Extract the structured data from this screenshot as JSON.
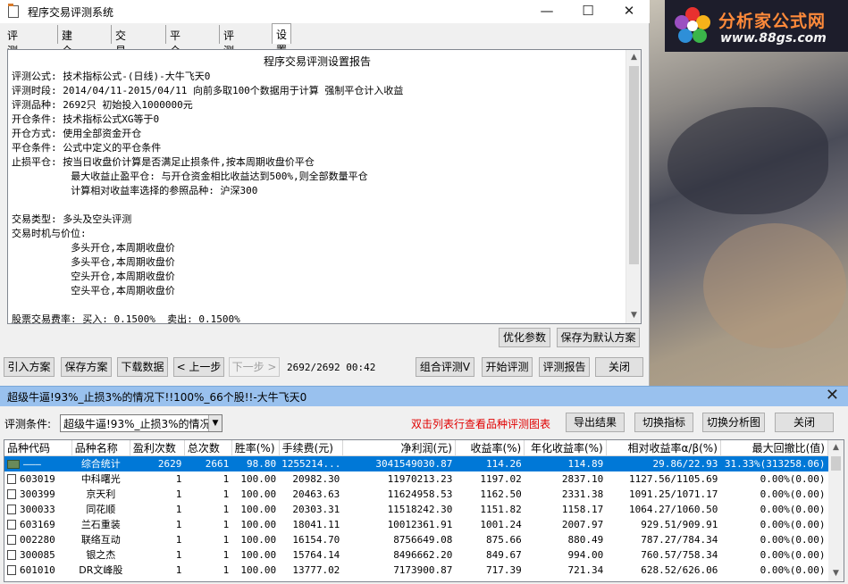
{
  "background": {
    "logo_brand": "分析家公式网",
    "logo_url": "www.88gs.com"
  },
  "main_window": {
    "title": "程序交易评测系统",
    "controls": {
      "minimize": "—",
      "maximize": "☐",
      "close": "✕"
    },
    "tabs": [
      "评测公式",
      "建仓规则",
      "交易方式",
      "平仓规则",
      "评测品种",
      "设置报告"
    ],
    "active_tab": "设置报告",
    "report": {
      "heading": "程序交易评测设置报告",
      "lines": [
        "评测公式: 技术指标公式-(日线)-大牛飞天0",
        "评测时段: 2014/04/11-2015/04/11 向前多取100个数据用于计算 强制平仓计入收益",
        "评测品种: 2692只 初始投入1000000元",
        "开仓条件: 技术指标公式XG等于0",
        "开仓方式: 使用全部资金开仓",
        "平仓条件: 公式中定义的平仓条件",
        "止损平仓: 按当日收盘价计算是否满足止损条件,按本周期收盘价平仓",
        "          最大收益止盈平仓: 与开仓资金相比收益达到500%,则全部数量平仓",
        "          计算相对收益率选择的参照品种: 沪深300",
        "",
        "交易类型: 多头及空头评测",
        "交易时机与价位:",
        "          多头开仓,本周期收盘价",
        "          多头平仓,本周期收盘价",
        "          空头开仓,本周期收盘价",
        "          空头平仓,本周期收盘价",
        "",
        "股票交易费率: 买入: 0.1500%  卖出: 0.1500%"
      ]
    },
    "buttons": {
      "optimize": "优化参数",
      "save_default": "保存为默认方案",
      "import": "引入方案",
      "save": "保存方案",
      "download": "下载数据",
      "prev": "< 上一步",
      "next": "下一步 >",
      "combo_eval": "组合评测V",
      "start_eval": "开始评测",
      "eval_report": "评测报告",
      "close": "关闭"
    },
    "status": "2692/2692 00:42"
  },
  "result_window": {
    "title": "超级牛逼!93%_止损3%的情况下!!100%_66个股!!-大牛飞天0",
    "condition_label": "评测条件:",
    "condition_value": "超级牛逼!93%_止损3%的情况下",
    "hint": "双击列表行查看品种评测图表",
    "buttons": {
      "export": "导出结果",
      "switch_indicator": "切换指标",
      "switch_chart": "切换分析图",
      "close": "关闭"
    },
    "columns": [
      "品种代码",
      "品种名称",
      "盈利次数",
      "总次数",
      "胜率(%)",
      "手续费(元)",
      "净利润(元)",
      "收益率(%)",
      "年化收益率(%)",
      "相对收益率α/β(%)",
      "最大回撤比(值)"
    ],
    "rows": [
      [
        "———",
        "综合统计",
        "2629",
        "2661",
        "98.80",
        "1255214...",
        "3041549030.87",
        "114.26",
        "114.89",
        "29.86/22.93",
        "31.33%(313258.06)"
      ],
      [
        "603019",
        "中科曙光",
        "1",
        "1",
        "100.00",
        "20982.30",
        "11970213.23",
        "1197.02",
        "2837.10",
        "1127.56/1105.69",
        "0.00%(0.00)"
      ],
      [
        "300399",
        "京天利",
        "1",
        "1",
        "100.00",
        "20463.63",
        "11624958.53",
        "1162.50",
        "2331.38",
        "1091.25/1071.17",
        "0.00%(0.00)"
      ],
      [
        "300033",
        "同花顺",
        "1",
        "1",
        "100.00",
        "20303.31",
        "11518242.30",
        "1151.82",
        "1158.17",
        "1064.27/1060.50",
        "0.00%(0.00)"
      ],
      [
        "603169",
        "兰石重装",
        "1",
        "1",
        "100.00",
        "18041.11",
        "10012361.91",
        "1001.24",
        "2007.97",
        "929.51/909.91",
        "0.00%(0.00)"
      ],
      [
        "002280",
        "联络互动",
        "1",
        "1",
        "100.00",
        "16154.70",
        "8756649.08",
        "875.66",
        "880.49",
        "787.27/784.34",
        "0.00%(0.00)"
      ],
      [
        "300085",
        "银之杰",
        "1",
        "1",
        "100.00",
        "15764.14",
        "8496662.20",
        "849.67",
        "994.00",
        "760.57/758.34",
        "0.00%(0.00)"
      ],
      [
        "601010",
        "DR文峰股",
        "1",
        "1",
        "100.00",
        "13777.02",
        "7173900.87",
        "717.39",
        "721.34",
        "628.52/626.06",
        "0.00%(0.00)"
      ]
    ]
  }
}
